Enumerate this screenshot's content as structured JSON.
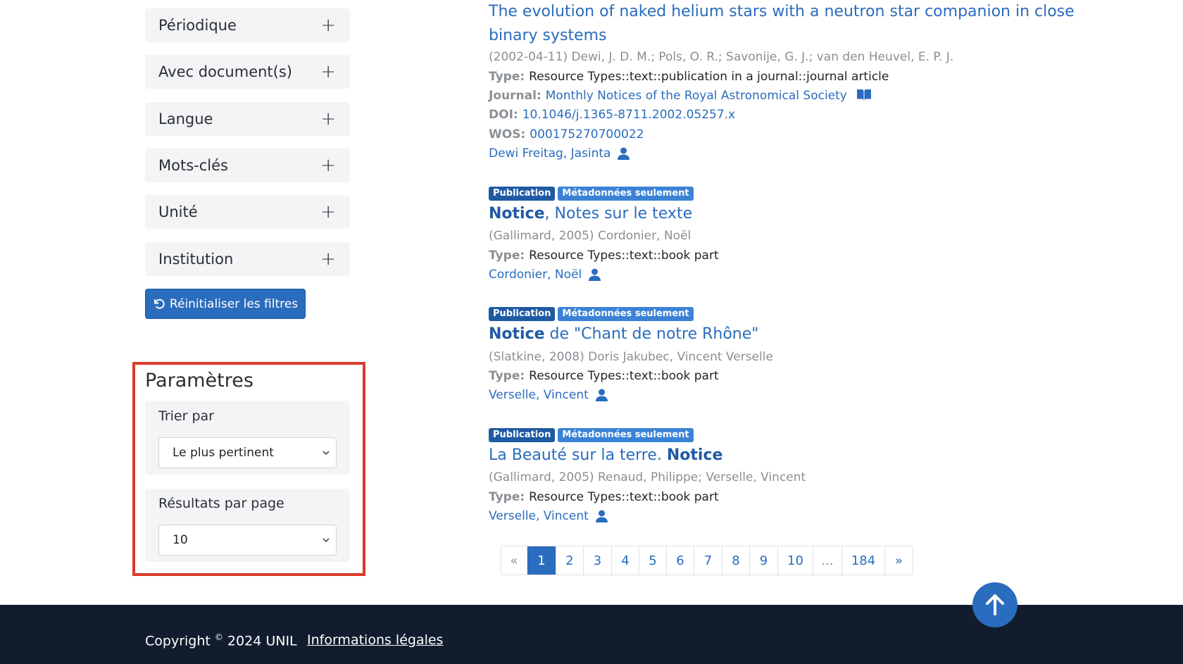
{
  "sidebar": {
    "facets": [
      {
        "label": "Périodique"
      },
      {
        "label": "Avec document(s)"
      },
      {
        "label": "Langue"
      },
      {
        "label": "Mots-clés"
      },
      {
        "label": "Unité"
      },
      {
        "label": "Institution"
      }
    ],
    "plus_glyph": "+",
    "reset_label": "Réinitialiser les filtres"
  },
  "params": {
    "title": "Paramètres",
    "sort_label": "Trier par",
    "sort_value": "Le plus pertinent",
    "per_page_label": "Résultats par page",
    "per_page_value": "10"
  },
  "results": [
    {
      "title_line1": "The evolution of naked helium stars with a neutron star companion in close",
      "title_line2": "binary systems",
      "meta": "(2002-04-11) Dewi, J. D. M.; Pols, O. R.; Savonije, G. J.; van den Heuvel, E. P. J.",
      "type_key": "Type:",
      "type_value": "Resource Types::text::publication in a journal::journal article",
      "journal_key": "Journal:",
      "journal_value": "Monthly Notices of the Royal Astronomical Society",
      "doi_key": "DOI:",
      "doi_value": "10.1046/j.1365-8711.2002.05257.x",
      "wos_key": "WOS:",
      "wos_value": "000175270700022",
      "author": "Dewi Freitag, Jasinta"
    },
    {
      "badge1": "Publication",
      "badge2": "Métadonnées seulement",
      "title_bold": "Notice",
      "title_rest": ", Notes sur le texte",
      "meta": "(Gallimard, 2005) Cordonier, Noël",
      "type_key": "Type:",
      "type_value": "Resource Types::text::book part",
      "author": "Cordonier, Noël"
    },
    {
      "badge1": "Publication",
      "badge2": "Métadonnées seulement",
      "title_bold": "Notice",
      "title_rest": " de \"Chant de notre Rhône\"",
      "meta": "(Slatkine, 2008) Doris Jakubec, Vincent Verselle",
      "type_key": "Type:",
      "type_value": "Resource Types::text::book part",
      "author": "Verselle, Vincent"
    },
    {
      "badge1": "Publication",
      "badge2": "Métadonnées seulement",
      "title_rest": "La Beauté sur la terre. ",
      "title_bold": "Notice",
      "meta": "(Gallimard, 2005) Renaud, Philippe; Verselle, Vincent",
      "type_key": "Type:",
      "type_value": "Resource Types::text::book part",
      "author": "Verselle, Vincent"
    }
  ],
  "pagination": {
    "items": [
      "«",
      "1",
      "2",
      "3",
      "4",
      "5",
      "6",
      "7",
      "8",
      "9",
      "10",
      "...",
      "184",
      "»"
    ],
    "active": "1"
  },
  "footer": {
    "copyright_pre": "Copyright ",
    "copyright_sup": "©",
    "copyright_post": " 2024 UNIL",
    "legal": "Informations légales"
  }
}
